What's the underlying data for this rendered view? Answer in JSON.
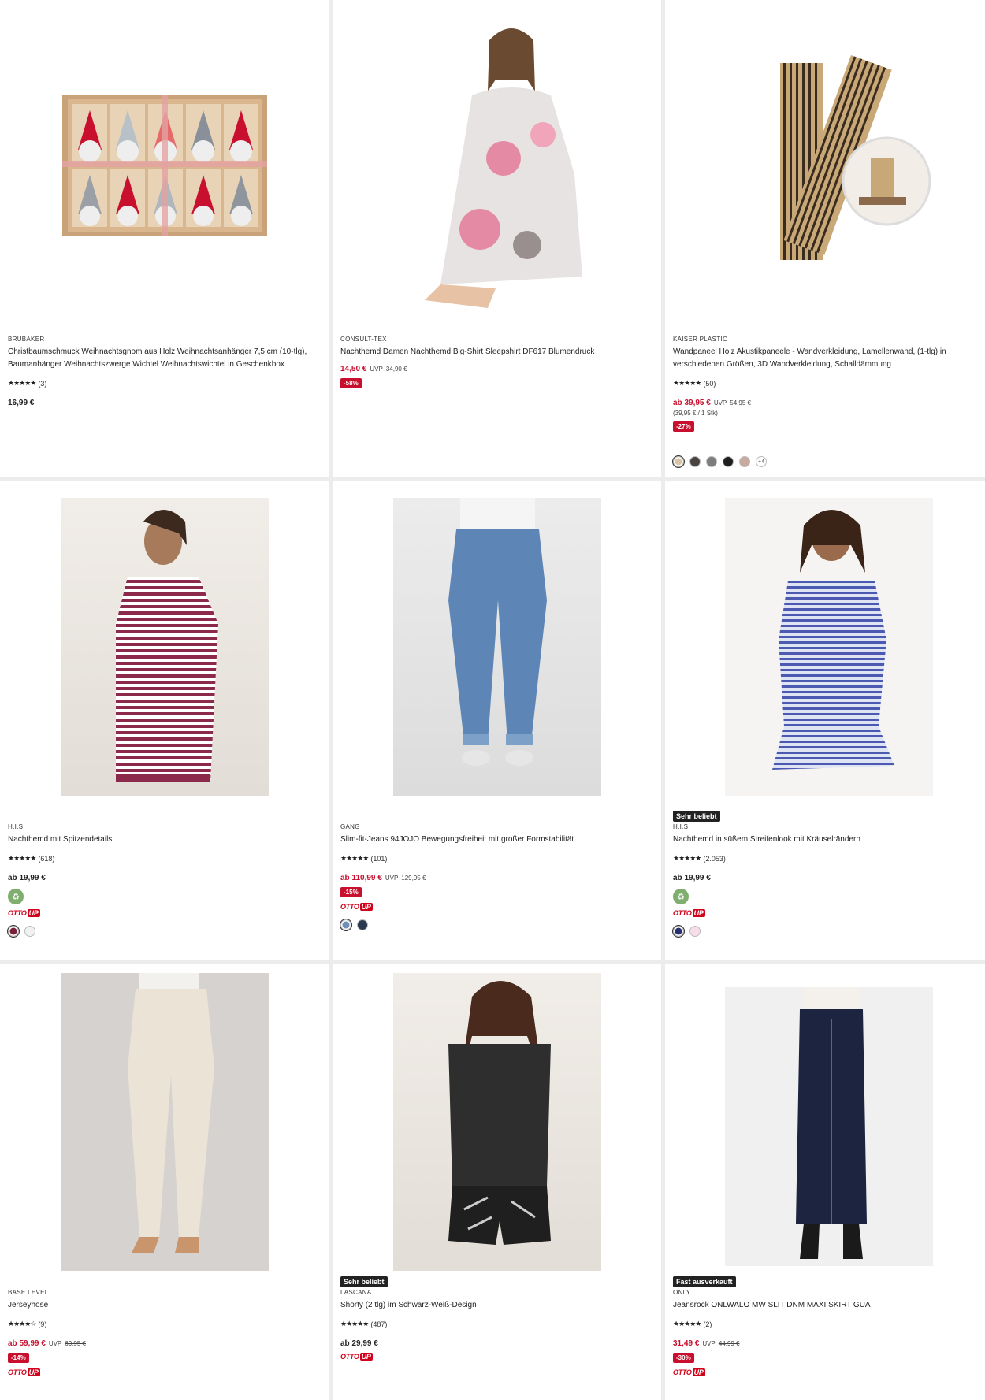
{
  "products": [
    {
      "brand": "BRUBAKER",
      "title": "Christbaumschmuck Weihnachtsgnom aus Holz Weihnachtsanhänger 7,5 cm (10-tlg), Baumanhänger Weihnachtszwerge Wichtel Weihnachtswichtel in Geschenkbox",
      "stars": "★★★★★",
      "reviews": "(3)",
      "price": "16,99 €",
      "image_icon": "gnome-ornament-box-image"
    },
    {
      "brand": "CONSULT-TEX",
      "title": "Nachthemd Damen Nachthemd Big-Shirt Sleepshirt DF617 Blumendruck",
      "price": "14,50 €",
      "uvp_label": "UVP",
      "uvp": "34,90 €",
      "discount": "-58%",
      "image_icon": "floral-nightshirt-image"
    },
    {
      "brand": "KAISER PLASTIC",
      "title": "Wandpaneel Holz Akustikpaneele - Wandverkleidung, Lamellenwand, (1-tlg) in verschiedenen Größen, 3D Wandverkleidung, Schalldämmung",
      "stars": "★★★★★",
      "reviews": "(50)",
      "price": "ab 39,95 €",
      "uvp_label": "UVP",
      "uvp": "54,95 €",
      "unit_price": "(39,95 € / 1 Stk)",
      "discount": "-27%",
      "swatches": [
        "#d8c3a5",
        "#4a4440",
        "#7d7d7d",
        "#1e1e1e",
        "#c9aaa0"
      ],
      "more_colors": "+4",
      "image_icon": "wood-panel-image"
    },
    {
      "brand": "H.I.S",
      "title": "Nachthemd mit Spitzendetails",
      "stars": "★★★★★",
      "reviews": "(618)",
      "price": "ab 19,99 €",
      "eco": true,
      "otto_up": true,
      "swatches": [
        "#7a1f3a",
        "#f1f1f1"
      ],
      "image_icon": "striped-nightdress-image"
    },
    {
      "brand": "GANG",
      "title": "Slim-fit-Jeans 94JOJO Bewegungsfreiheit mit großer Formstabilität",
      "stars": "★★★★★",
      "reviews": "(101)",
      "price": "ab 110,99 €",
      "uvp_label": "UVP",
      "uvp": "129,95 €",
      "discount": "-15%",
      "otto_up": true,
      "swatches": [
        "#6f8fb8",
        "#2b3a4f"
      ],
      "image_icon": "jeans-image"
    },
    {
      "brand": "H.I.S",
      "title": "Nachthemd in süßem Streifenlook mit Kräuselrändern",
      "badge": "Sehr beliebt",
      "stars": "★★★★★",
      "reviews": "(2.053)",
      "price": "ab 19,99 €",
      "eco": true,
      "otto_up": true,
      "swatches": [
        "#27306f",
        "#f8dde8"
      ],
      "image_icon": "blue-striped-nightdress-image"
    },
    {
      "brand": "BASE LEVEL",
      "title": "Jerseyhose",
      "stars": "★★★★☆",
      "reviews": "(9)",
      "price": "ab 59,99 €",
      "uvp_label": "UVP",
      "uvp": "69,95 €",
      "discount": "-14%",
      "otto_up": true,
      "image_icon": "beige-trousers-image"
    },
    {
      "brand": "LASCANA",
      "title": "Shorty (2 tlg) im Schwarz-Weiß-Design",
      "badge": "Sehr beliebt",
      "stars": "★★★★★",
      "reviews": "(487)",
      "price": "ab 29,99 €",
      "otto_up": true,
      "image_icon": "black-shorty-image"
    },
    {
      "brand": "ONLY",
      "title": "Jeansrock ONLWALO MW SLIT DNM MAXI SKIRT GUA",
      "badge": "Fast ausverkauft",
      "stars": "★★★★★",
      "reviews": "(2)",
      "price": "31,49 €",
      "uvp_label": "UVP",
      "uvp": "44,99 €",
      "discount": "-30%",
      "otto_up": true,
      "image_icon": "denim-maxi-skirt-image"
    }
  ],
  "otto_up_label": {
    "a": "OTTO",
    "b": "UP"
  },
  "eco_icon": "♻",
  "colors": {
    "sale": "#c8102e",
    "eco": "#7fae6e",
    "badge": "#222222"
  }
}
